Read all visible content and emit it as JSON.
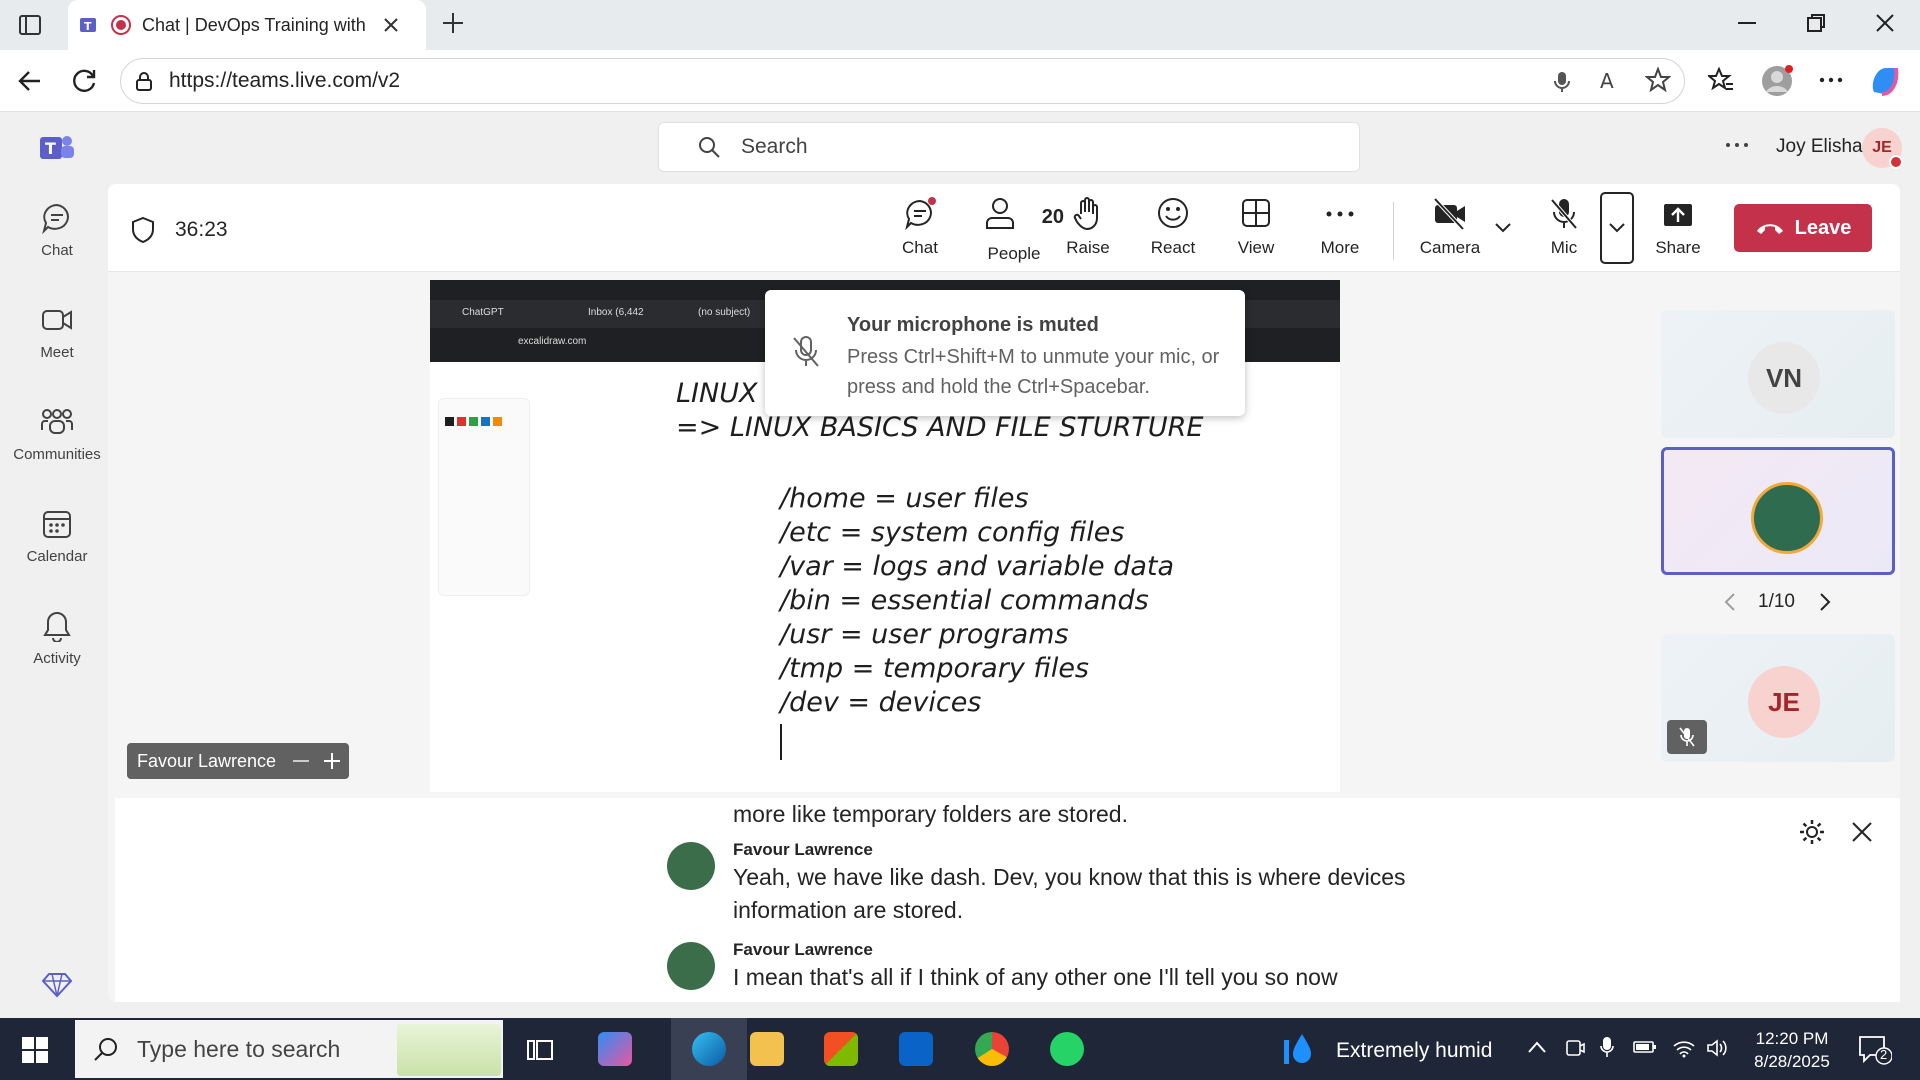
{
  "browser": {
    "tab_title": "Chat | DevOps Training with I",
    "url": "https://teams.live.com/v2"
  },
  "teams": {
    "search_placeholder": "Search",
    "user_name": "Joy Elisha",
    "user_initials": "JE",
    "rail": [
      "Chat",
      "Meet",
      "Communities",
      "Calendar",
      "Activity"
    ]
  },
  "meeting": {
    "timer": "36:23",
    "people_count": "20",
    "controls": {
      "chat": "Chat",
      "people": "People",
      "raise": "Raise",
      "react": "React",
      "view": "View",
      "more": "More",
      "camera": "Camera",
      "mic": "Mic",
      "share": "Share",
      "leave": "Leave"
    },
    "presenter_name": "Favour Lawrence",
    "pagination": "1/10",
    "tiles": [
      {
        "initials": "VN"
      },
      {
        "initials": ""
      },
      {
        "initials": "JE"
      }
    ]
  },
  "shared_screen": {
    "browser_tabs": [
      "ChatGPT",
      "Inbox (6,442",
      "(no subject)"
    ],
    "url": "excalidraw.com",
    "heading_partial": "LINUX",
    "heading": "=> LINUX BASICS AND FILE STURTURE",
    "notes": [
      "/home = user files",
      "/etc = system config files",
      "/var = logs and variable data",
      "/bin = essential commands",
      "/usr = user programs",
      "/tmp = temporary files",
      "/dev = devices"
    ]
  },
  "toast": {
    "title": "Your microphone is muted",
    "body": "Press Ctrl+Shift+M to unmute your mic, or press and hold the Ctrl+Spacebar."
  },
  "captions": {
    "previous_fragment": "more like temporary folders are stored.",
    "entries": [
      {
        "speaker": "Favour Lawrence",
        "text": "Yeah, we have like dash. Dev, you know that this is where devices information are stored."
      },
      {
        "speaker": "Favour Lawrence",
        "text": "I mean that's all if I think of any other one I'll tell you so now"
      }
    ]
  },
  "taskbar": {
    "search_placeholder": "Type here to search",
    "weather": "Extremely humid",
    "time": "12:20 PM",
    "date": "8/28/2025",
    "notification_count": "2"
  },
  "colors": {
    "leave": "#c4314b",
    "teams_brand": "#5b5fc7",
    "taskbar": "#1f2637"
  }
}
